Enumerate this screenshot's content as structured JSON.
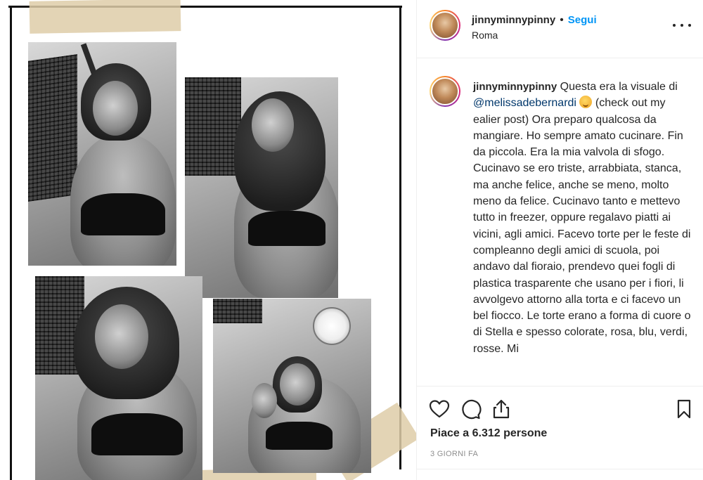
{
  "post": {
    "username": "jinnyminnypinny",
    "separator": "•",
    "follow_label": "Segui",
    "location": "Roma"
  },
  "caption": {
    "username": "jinnyminnypinny",
    "text_before_mention": "Questa era la visuale di ",
    "mention": "@melissadebernardi",
    "emoji_name": "winking-face-emoji",
    "text_after_mention": "(check out my ealier post) Ora preparo qualcosa da mangiare. Ho sempre amato cucinare. Fin da piccola. Era la mia valvola di sfogo. Cucinavo se ero triste, arrabbiata, stanca, ma anche felice, anche se meno, molto meno da felice. Cucinavo tanto e mettevo tutto in freezer, oppure regalavo piatti ai vicini, agli amici. Facevo torte per le feste di compleanno degli amici di scuola, poi andavo dal fioraio, prendevo quei fogli di plastica trasparente che usano per i fiori, li avvolgevo attorno alla torta e ci facevo un bel fiocco. Le torte erano a forma di cuore o di Stella e spesso colorate, rosa, blu, verdi, rosse. Mi"
  },
  "actions": {
    "like_icon": "heart-icon",
    "comment_icon": "comment-icon",
    "share_icon": "share-icon",
    "save_icon": "bookmark-icon"
  },
  "likes_text": "Piace a 6.312 persone",
  "timestamp": "3 GIORNI FA",
  "colors": {
    "link_blue": "#0095f6",
    "mention_blue": "#00376b",
    "text": "#262626",
    "muted": "#8e8e8e",
    "divider": "#efefef"
  }
}
